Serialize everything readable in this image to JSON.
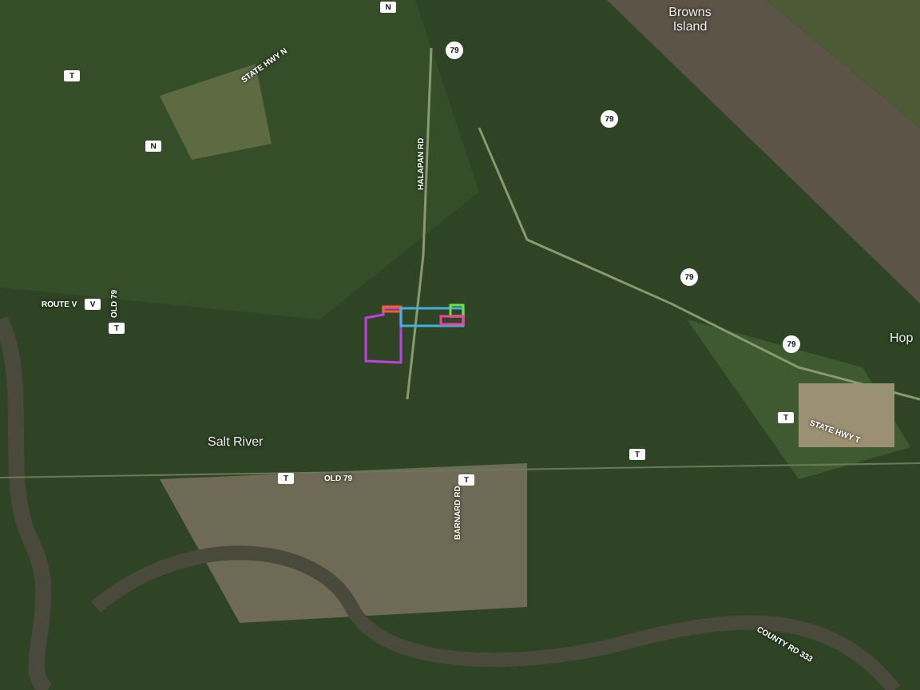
{
  "map": {
    "place_labels": [
      {
        "text": "Browns Island"
      },
      {
        "text": "Salt River"
      },
      {
        "text": "Hop"
      }
    ],
    "road_labels": [
      {
        "text": "STATE HWY N"
      },
      {
        "text": "ROUTE V"
      },
      {
        "text": "OLD 79"
      },
      {
        "text": "HALAPAN RD"
      },
      {
        "text": "OLD 79"
      },
      {
        "text": "BARNARD RD"
      },
      {
        "text": "STATE HWY T"
      },
      {
        "text": "COUNTY RD 333"
      }
    ],
    "shields": [
      {
        "text": "N",
        "kind": "square"
      },
      {
        "text": "T",
        "kind": "square"
      },
      {
        "text": "N",
        "kind": "square"
      },
      {
        "text": "79",
        "kind": "circle"
      },
      {
        "text": "79",
        "kind": "circle"
      },
      {
        "text": "79",
        "kind": "circle"
      },
      {
        "text": "79",
        "kind": "circle"
      },
      {
        "text": "V",
        "kind": "square"
      },
      {
        "text": "T",
        "kind": "square"
      },
      {
        "text": "T",
        "kind": "square"
      },
      {
        "text": "T",
        "kind": "square"
      },
      {
        "text": "T",
        "kind": "square"
      },
      {
        "text": "T",
        "kind": "square"
      }
    ],
    "parcels": [
      {
        "color": "#c040e0"
      },
      {
        "color": "#f06030"
      },
      {
        "color": "#40b0e0"
      },
      {
        "color": "#70e040"
      },
      {
        "color": "#f040a0"
      }
    ]
  }
}
